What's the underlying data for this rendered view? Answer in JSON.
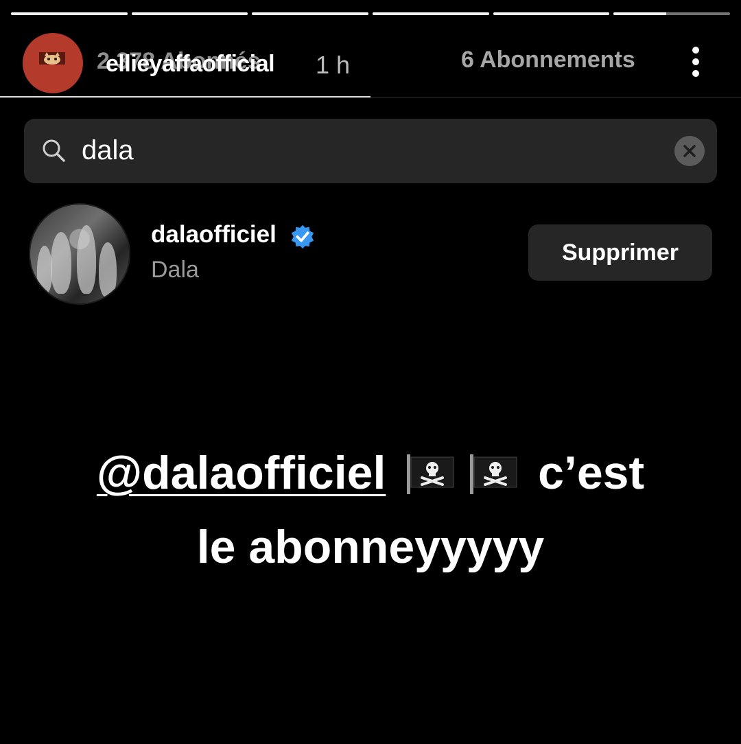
{
  "story": {
    "progress_segments": [
      1,
      1,
      1,
      1,
      1,
      0.45
    ]
  },
  "header": {
    "followers_overlay": "2 378 Abonnés",
    "username": "ellieyaffaofficial",
    "time": "1 h",
    "following": "6 Abonnements",
    "more_icon": "vertical-dots-icon"
  },
  "search": {
    "icon": "search-icon",
    "query": "dala",
    "clear_icon": "clear-icon"
  },
  "result": {
    "username": "dalaofficiel",
    "verified_icon": "verified-badge-icon",
    "verified_color": "#3897f0",
    "full_name": "Dala",
    "action_label": "Supprimer"
  },
  "caption": {
    "mention": "@dalaofficiel",
    "emoji": "pirate-flag-icon",
    "line1_text": "c’est",
    "line2_text": "le abonneyyyyy"
  }
}
